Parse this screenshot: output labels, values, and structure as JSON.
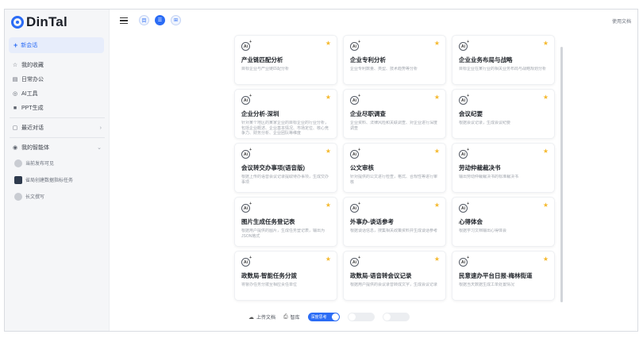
{
  "app": {
    "name": "DinTal"
  },
  "sidebar": {
    "new_chat": "新会话",
    "items": [
      {
        "label": "我的收藏",
        "icon": "star-icon"
      },
      {
        "label": "日常办公",
        "icon": "office-icon"
      },
      {
        "label": "AI工具",
        "icon": "ai-tool-icon"
      },
      {
        "label": "PPT生成",
        "icon": "ppt-icon"
      }
    ],
    "recent": "最近对话",
    "my_agents": "我的智能体",
    "agents": [
      "当前发布可见",
      "省局创建数据指标任务",
      "长文撰写"
    ]
  },
  "topbar": {
    "help": "使用文档",
    "buttons": [
      "目",
      "☰",
      "⊞"
    ]
  },
  "cards": [
    {
      "title": "产业链匹配分析",
      "desc": "目标企业与产业链匹配分析"
    },
    {
      "title": "企业专利分析",
      "desc": "企业专利数量、类型、技术趋势等分析"
    },
    {
      "title": "企业业务布局与战略",
      "desc": "目标企业在某行业的相关业务布局与战略规划分析"
    },
    {
      "title": "企业分析-深圳",
      "desc": "针对某个地区的某家企业的目标企业的行业分析，包括企业概述、企业基本情况、市场定位、核心竞争力、财务分析、企业团队等维度"
    },
    {
      "title": "企业尽职调查",
      "desc": "企业资料、法律风险和关联调查、对企业进行深度调查"
    },
    {
      "title": "会议纪要",
      "desc": "根据会议记录，生成会议纪要"
    },
    {
      "title": "会议转交办事项(语音版)",
      "desc": "根据上传的语音会议记录提取待办事项，生成交办事项"
    },
    {
      "title": "公文审核",
      "desc": "针对提供的公文进行检查，格式、合规性等进行审核"
    },
    {
      "title": "劳动仲裁裁决书",
      "desc": "输出劳动仲裁裁决书的标准裁决书"
    },
    {
      "title": "图片生成任务登记表",
      "desc": "根据用户提供的图片，生成任务登记表，输出为JSON格式"
    },
    {
      "title": "外事办-谈话参考",
      "desc": "根据谈话信息，搜集相关政策资料并生成谈话参考"
    },
    {
      "title": "心得体会",
      "desc": "根据学习文档输出心得体会"
    },
    {
      "title": "政数局-智能任务分拨",
      "desc": "将督办任务分拨至相应责任单位"
    },
    {
      "title": "政数局-语音转会议记录",
      "desc": "根据用户提供的会议录音转成文字，生成会议记录"
    },
    {
      "title": "民意速办平台日报-梅林街道",
      "desc": "根据当天数据生成工单处置情况"
    }
  ],
  "bottom": {
    "upload": "上传文档",
    "print": "智库",
    "toggle_label": "深度思考"
  },
  "colors": {
    "accent": "#2b6cf5",
    "star": "#f5b92e"
  }
}
